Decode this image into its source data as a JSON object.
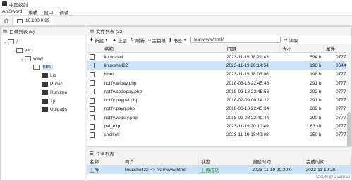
{
  "window": {
    "title": "中国蚁剑"
  },
  "menubar": [
    "AntSword",
    "编辑",
    "窗口",
    "调试"
  ],
  "tabs": [
    {
      "label": "10.100.0.99"
    }
  ],
  "dir_panel": {
    "title": "目录列表 (5)",
    "tree": [
      {
        "label": "/",
        "level": 0,
        "dark": false,
        "expanded": true
      },
      {
        "label": "var",
        "level": 1,
        "dark": false,
        "expanded": true
      },
      {
        "label": "www",
        "level": 2,
        "dark": false,
        "expanded": true
      },
      {
        "label": "html",
        "level": 3,
        "dark": false,
        "expanded": true,
        "selected": true
      },
      {
        "label": "Lib",
        "level": 4,
        "dark": true
      },
      {
        "label": "Public",
        "level": 4,
        "dark": true
      },
      {
        "label": "Runtime",
        "level": 4,
        "dark": true
      },
      {
        "label": "Tpl",
        "level": 4,
        "dark": true
      },
      {
        "label": "Uploads",
        "level": 4,
        "dark": true
      }
    ]
  },
  "file_panel": {
    "title": "文件列表 (32)",
    "toolbar": {
      "new": "新建",
      "up": "上层",
      "refresh": "刷新",
      "home": "主目录",
      "bookmark": "书签",
      "path": "/var/www/html/",
      "read": "读取"
    },
    "columns": [
      "名称",
      "日期",
      "大小",
      "属性"
    ],
    "rows": [
      {
        "name": "linuxshell",
        "date": "2023-11-19 18:21:43",
        "size": "594 b",
        "attr": "0777",
        "selected": false
      },
      {
        "name": "linuxshell22",
        "date": "2023-11-19 20:14:54",
        "size": "198 b",
        "attr": "0644",
        "selected": true
      },
      {
        "name": "lshell",
        "date": "2023-11-19 18:05:06",
        "size": "198 b",
        "attr": "0777",
        "selected": false
      },
      {
        "name": "notify.alipay.php",
        "date": "2018-03-18 22:45:48",
        "size": "291 b",
        "attr": "0777",
        "selected": false
      },
      {
        "name": "notify.codepay.php",
        "date": "2018-03-18 22:45:56",
        "size": "292 b",
        "attr": "0777",
        "selected": false
      },
      {
        "name": "notify.paypal.php",
        "date": "2018-02-09 00:14:22",
        "size": "291 b",
        "attr": "0777",
        "selected": false
      },
      {
        "name": "notify.payrj.php",
        "date": "2018-03-18 22:45:34",
        "size": "289 b",
        "attr": "0777",
        "selected": false
      },
      {
        "name": "notify.wxpay.php",
        "date": "2018-02-08 22:49:44",
        "size": "290 b",
        "attr": "0777",
        "selected": false
      },
      {
        "name": "pai_exp",
        "date": "2023-11-19 20:10:49",
        "size": "1.63 kb",
        "attr": "0777",
        "selected": false
      },
      {
        "name": "shell.elf",
        "date": "2023-11-19 18:49:08",
        "size": "250 b",
        "attr": "0777",
        "selected": false
      }
    ]
  },
  "task_panel": {
    "title": "任务列表",
    "columns": [
      "名称",
      "简介",
      "状态",
      "创建时间",
      "完成时间"
    ],
    "rows": [
      {
        "name": "上传",
        "desc": "linuxshell22 => /var/www/html/",
        "status": "上传成功",
        "created": "2023-11-19 20:20:0",
        "finished": "2023-11-19 20:"
      }
    ]
  },
  "watermark": "CSDN @Guanrao"
}
